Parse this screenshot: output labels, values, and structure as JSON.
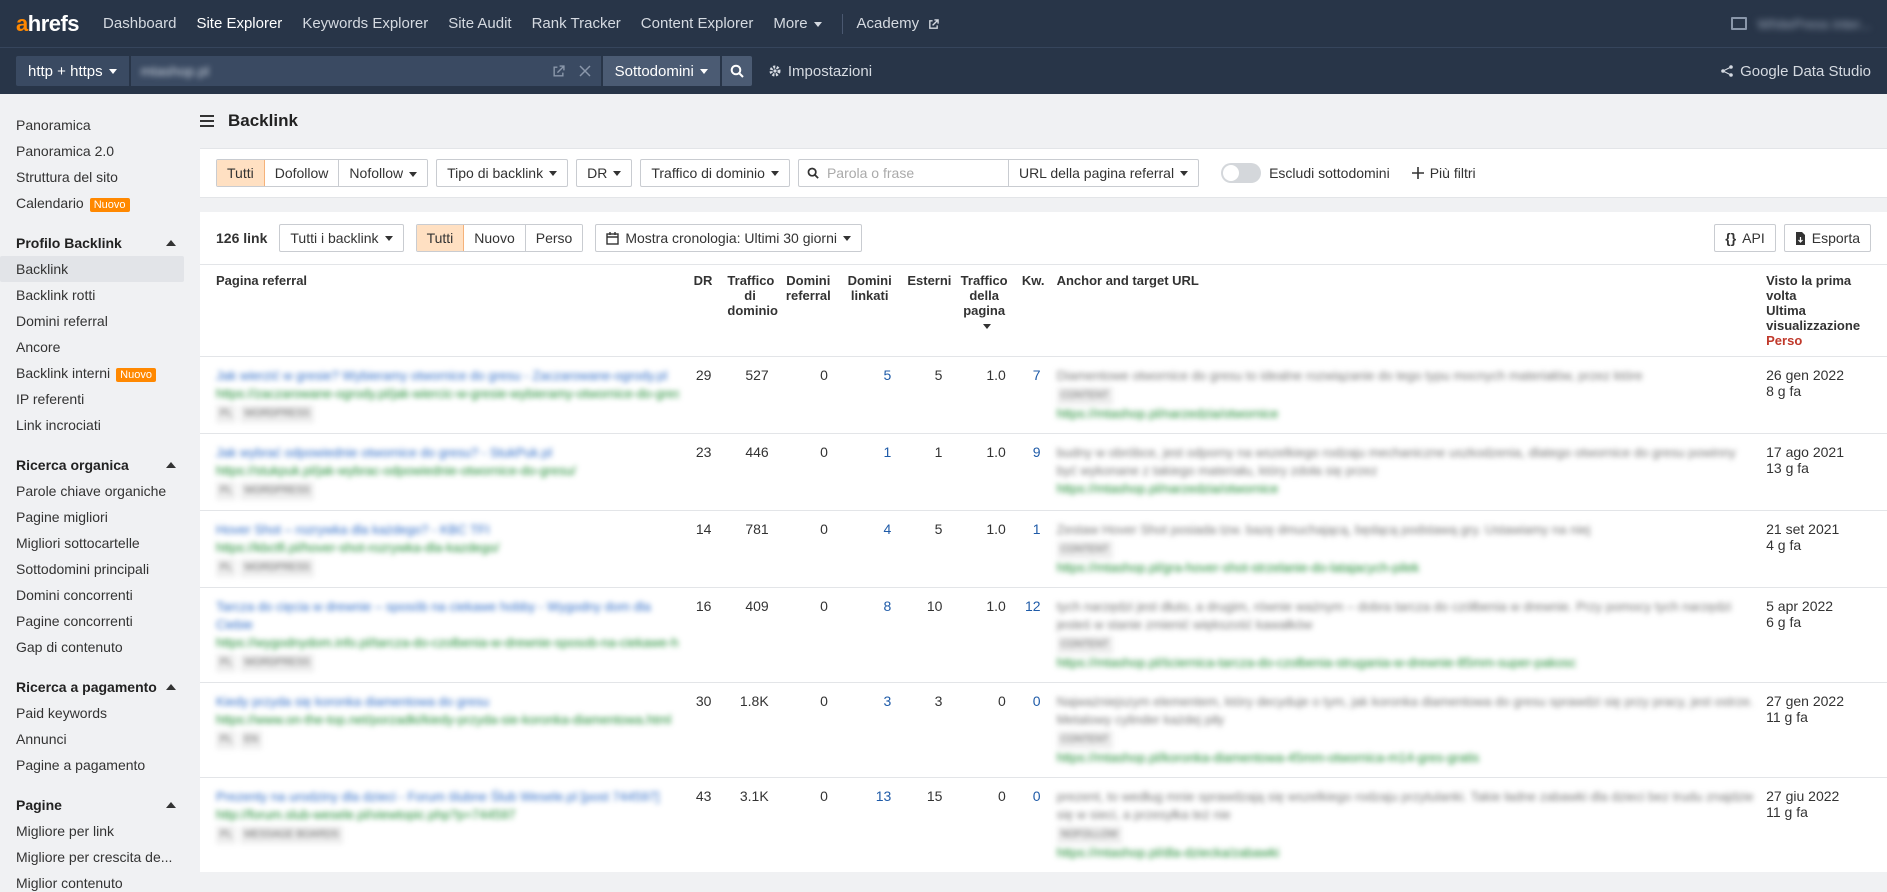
{
  "brand": {
    "a": "a",
    "rest": "hrefs"
  },
  "nav": [
    {
      "label": "Dashboard",
      "active": false
    },
    {
      "label": "Site Explorer",
      "active": true
    },
    {
      "label": "Keywords Explorer",
      "active": false
    },
    {
      "label": "Site Audit",
      "active": false
    },
    {
      "label": "Rank Tracker",
      "active": false
    },
    {
      "label": "Content Explorer",
      "active": false
    }
  ],
  "nav_more": "More",
  "nav_academy": "Academy",
  "account_name": "WhitePress inter...",
  "search": {
    "protocol": "http + https",
    "url_value": "mtashop.pl",
    "mode": "Sottodomini",
    "settings": "Impostazioni",
    "gds": "Google Data Studio"
  },
  "sidebar": {
    "top": [
      {
        "label": "Panoramica"
      },
      {
        "label": "Panoramica 2.0"
      },
      {
        "label": "Struttura del sito"
      },
      {
        "label": "Calendario",
        "badge": "Nuovo"
      }
    ],
    "sections": [
      {
        "title": "Profilo Backlink",
        "items": [
          {
            "label": "Backlink",
            "active": true
          },
          {
            "label": "Backlink rotti"
          },
          {
            "label": "Domini referral"
          },
          {
            "label": "Ancore"
          },
          {
            "label": "Backlink interni",
            "badge": "Nuovo"
          },
          {
            "label": "IP referenti"
          },
          {
            "label": "Link incrociati"
          }
        ]
      },
      {
        "title": "Ricerca organica",
        "items": [
          {
            "label": "Parole chiave organiche"
          },
          {
            "label": "Pagine migliori"
          },
          {
            "label": "Migliori sottocartelle"
          },
          {
            "label": "Sottodomini principali"
          },
          {
            "label": "Domini concorrenti"
          },
          {
            "label": "Pagine concorrenti"
          },
          {
            "label": "Gap di contenuto"
          }
        ]
      },
      {
        "title": "Ricerca a pagamento",
        "items": [
          {
            "label": "Paid keywords"
          },
          {
            "label": "Annunci"
          },
          {
            "label": "Pagine a pagamento"
          }
        ]
      },
      {
        "title": "Pagine",
        "items": [
          {
            "label": "Migliore per link"
          },
          {
            "label": "Migliore per crescita de..."
          },
          {
            "label": "Miglior contenuto"
          }
        ]
      }
    ]
  },
  "page_title": "Backlink",
  "filters": {
    "type_seg": [
      "Tutti",
      "Dofollow"
    ],
    "nofollow": "Nofollow",
    "backlink_type": "Tipo di backlink",
    "dr": "DR",
    "domain_traffic": "Traffico di dominio",
    "search_placeholder": "Parola o frase",
    "search_scope": "URL della pagina referral",
    "exclude_sub": "Escludi sottodomini",
    "more_filters": "Più filtri"
  },
  "panel": {
    "count": "126 link",
    "all_backlinks": "Tutti i backlink",
    "status_seg": [
      "Tutti",
      "Nuovo",
      "Perso"
    ],
    "history": "Mostra cronologia: Ultimi 30 giorni",
    "api": "API",
    "export": "Esporta"
  },
  "columns": {
    "referring_page": "Pagina referral",
    "dr": "DR",
    "domain_traffic": "Traffico di dominio",
    "ref_domains": "Domini referral",
    "linked_domains": "Domini linkati",
    "external": "Esterni",
    "page_traffic": "Traffico della pagina",
    "kw": "Kw.",
    "anchor": "Anchor and target URL",
    "first_seen": "Visto la prima volta",
    "last_seen": "Ultima visualizzazione",
    "lost": "Perso"
  },
  "rows": [
    {
      "title": "Jak wierzić w gresie? Wybieramy otwornice do gresu - Zaczarowane-ogrody.pl",
      "url": "https://zaczarowane-ogrody.pl/jak-wiercic-w-gresie-wybieramy-otwornice-do-gresu/",
      "tags": [
        "PL",
        "WORDPRESS"
      ],
      "dr": "29",
      "traffic": "527",
      "refdom": "0",
      "linked": "5",
      "ext": "5",
      "ptraffic": "1.0",
      "kw": "7",
      "anchor": "Diamentowe otwornice do gresu to idealne rozwiązanie do tego typu mocnych materiałów, przez które",
      "anchor_tag": "CONTENT",
      "target": "https://mtashop.pl/narzedzia/otwornice",
      "first": "26 gen 2022",
      "last": "8 g fa"
    },
    {
      "title": "Jak wybrać odpowiednie otwornice do gresu? - StukPuk.pl",
      "url": "https://stukpuk.pl/jak-wybrac-odpowiednie-otwornice-do-gresu/",
      "tags": [
        "PL",
        "WORDPRESS"
      ],
      "dr": "23",
      "traffic": "446",
      "refdom": "0",
      "linked": "1",
      "ext": "1",
      "ptraffic": "1.0",
      "kw": "9",
      "anchor": "budny w obróbce, jest odporny na wszelkiego rodzaju mechaniczne uszkodzenia, dlatego otwornice do gresu powinny być wykonane z takiego materiału, który zdoła się przez",
      "anchor_tag": "",
      "target": "https://mtashop.pl/narzedzia/otwornice",
      "first": "17 ago 2021",
      "last": "13 g fa"
    },
    {
      "title": "Hover Shot – rozrywka dla każdego? - KBC TFI",
      "url": "https://kbctfi.pl/hover-shot-rozrywka-dla-kazdego/",
      "tags": [
        "PL",
        "WORDPRESS"
      ],
      "dr": "14",
      "traffic": "781",
      "refdom": "0",
      "linked": "4",
      "ext": "5",
      "ptraffic": "1.0",
      "kw": "1",
      "anchor": "Zestaw Hover Shot posiada tzw. bazę dmuchającą, będącą podstawą gry. Ustawiamy na niej",
      "anchor_tag": "CONTENT",
      "target": "https://mtashop.pl/gra-hover-shot-strzelanie-do-latajacych-pilek",
      "first": "21 set 2021",
      "last": "4 g fa"
    },
    {
      "title": "Tarcza do cięcia w drewnie – sposób na ciekawe hobby - Wygodny dom dla Ciebie",
      "url": "https://wygodnydom.info.pl/tarcza-do-czolbenia-w-drewnie-sposob-na-ciekawe-hobby/",
      "tags": [
        "PL",
        "WORDPRESS"
      ],
      "dr": "16",
      "traffic": "409",
      "refdom": "0",
      "linked": "8",
      "ext": "10",
      "ptraffic": "1.0",
      "kw": "12",
      "anchor": "tych narzędzi jest dłuto, a drugim, równie ważnym – dobra tarcza do czółbenia w drewnie. Przy pomocy tych narzędzi jesteś w stanie zmienić większość kawałków",
      "anchor_tag": "CONTENT",
      "target": "https://mtashop.pl/ściernica-tarcza-do-czolbenia-strugania-w-drewnie-85mm-super-pakosc",
      "first": "5 apr 2022",
      "last": "6 g fa"
    },
    {
      "title": "Kiedy przyda się koronka diamentowa do gresu",
      "url": "https://www.on-the-top.net/porzadki/kiedy-przyda-sie-koronka-diamentowa.html",
      "tags": [
        "PL",
        "EN"
      ],
      "dr": "30",
      "traffic": "1.8K",
      "refdom": "0",
      "linked": "3",
      "ext": "3",
      "ptraffic": "0",
      "kw": "0",
      "anchor": "Najważniejszym elementem, który decyduje o tym, jak koronka diamentowa do gresu sprawdzi się przy pracy, jest ostrze. Metalowy cylinder każdej piły",
      "anchor_tag": "CONTENT",
      "target": "https://mtashop.pl/koronka-diamentowa-45mm-otwornica-m14-gres-gratis",
      "first": "27 gen 2022",
      "last": "11 g fa"
    },
    {
      "title": "Prezenty na urodziny dla dzieci - Forum ślubne Ślub Wesele.pl [post 744597]",
      "url": "http://forum.slub-wesele.pl/viewtopic.php?p=744597",
      "tags": [
        "PL",
        "MESSAGE BOARDS"
      ],
      "dr": "43",
      "traffic": "3.1K",
      "refdom": "0",
      "linked": "13",
      "ext": "15",
      "ptraffic": "0",
      "kw": "0",
      "anchor": "prezent, to według mnie sprawdzają się wszelkiego rodzaju przytulanki. Takie ładne zabawki dla dzieci bez trudu znajdzie się w sieci, a przesyłka też nie",
      "anchor_tag": "NOFOLLOW",
      "target": "https://mtashop.pl/dla-dziecka/zabawki",
      "first": "27 giu 2022",
      "last": "11 g fa"
    }
  ]
}
